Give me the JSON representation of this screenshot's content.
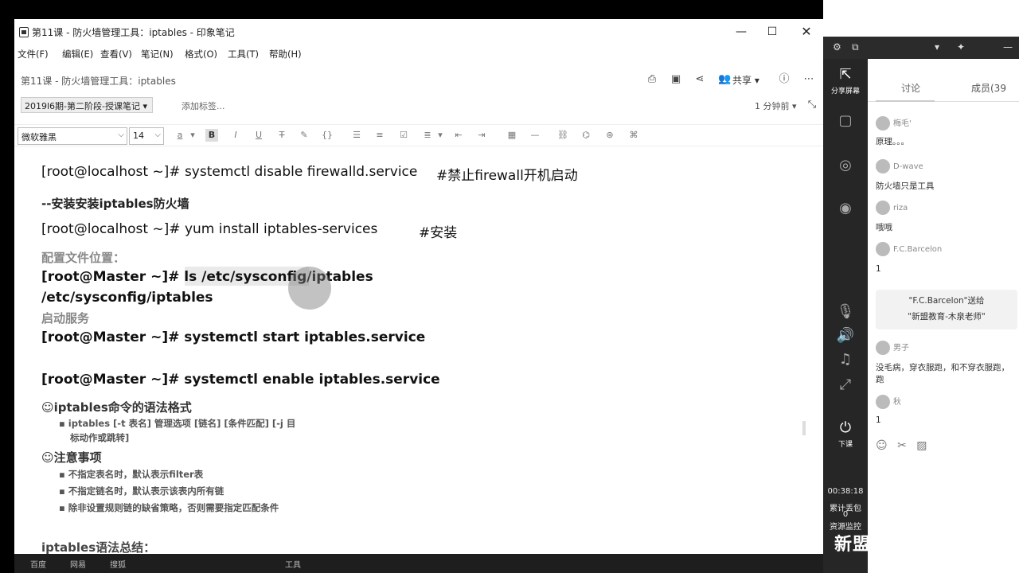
{
  "window": {
    "title": "第11课 - 防火墙管理工具：iptables - 印象笔记",
    "min": "—",
    "max": "☐",
    "close": "✕"
  },
  "menu": [
    "文件(F)",
    "编辑(E)",
    "查看(V)",
    "笔记(N)",
    "格式(O)",
    "工具(T)",
    "帮助(H)"
  ],
  "note": {
    "title": "第11课 - 防火墙管理工具：iptables",
    "share": "共享 ▾",
    "notebook": "2019l6期-第二阶段-授课笔记 ▾",
    "add_tag": "添加标签...",
    "updated": "1 分钟前 ▾"
  },
  "format": {
    "font": "微软雅黑",
    "size": "14"
  },
  "content": {
    "cmd_disable": "[root@localhost ~]# systemctl disable firewalld.service",
    "cmd_disable_comment": "#禁止firewall开机启动",
    "install_heading": "--安装安装iptables防火墙",
    "cmd_install": "[root@localhost ~]# yum install iptables-services",
    "cmd_install_comment": "#安装",
    "config_heading": "配置文件位置：",
    "cmd_ls": "[root@Master ~]# ls /etc/sysconfig/iptables",
    "ls_output": "/etc/sysconfig/iptables",
    "start_heading": "启动服务",
    "cmd_start": "[root@Master ~]# systemctl start iptables.service",
    "cmd_enable": "[root@Master ~]# systemctl enable iptables.service",
    "syntax_heading": "☺iptables命令的语法格式",
    "syntax_line1": "▪ iptables  [-t 表名]  管理选项  [链名]  [条件匹配]  [-j 目",
    "syntax_line2": "标动作或跳转]",
    "notes_heading": "☺注意事项",
    "note1": "▪ 不指定表名时，默认表示filter表",
    "note2": "▪ 不指定链名时，默认表示该表内所有链",
    "note3": "▪ 除非设置规则链的缺省策略，否则需要指定匹配条件",
    "summary_heading": "iptables语法总结："
  },
  "side": {
    "share_screen": "分享屏幕",
    "end_class": "下课",
    "timer": "00:38:18",
    "tab_discuss": "讨论",
    "tab_members": "成员(39",
    "messages": [
      {
        "name": "梅毛'",
        "text": "原理。。。"
      },
      {
        "name": "D-wave",
        "text": "防火墙只是工具"
      },
      {
        "name": "riza",
        "text": "哦哦"
      },
      {
        "name": "F.C.Barcelon",
        "text": "1"
      },
      {
        "name": "男子",
        "text": "没毛病，穿衣服跑，和不穿衣服跑，跑"
      },
      {
        "name": "秋",
        "text": "1"
      }
    ],
    "gift_line1": "\"F.C.Barcelon\"送给",
    "gift_line2": "\"新盟教育-木泉老师\"",
    "stats1": "累计丢包",
    "stats2": "0",
    "stats3": "资源监控",
    "logo": "新盟"
  },
  "taskbar": [
    "百度",
    "网易",
    "搜狐",
    "工具"
  ]
}
